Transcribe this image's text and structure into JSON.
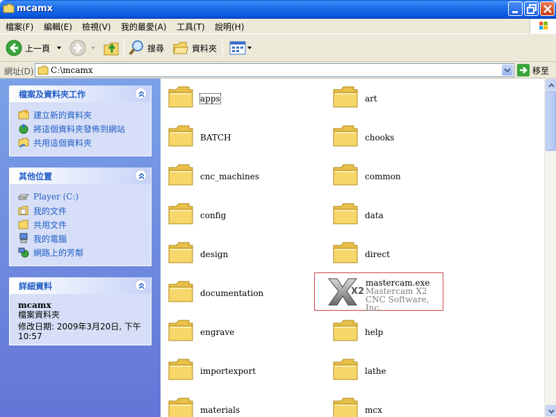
{
  "window": {
    "title": "mcamx"
  },
  "menu": {
    "items": [
      "檔案(F)",
      "編輯(E)",
      "檢視(V)",
      "我的最愛(A)",
      "工具(T)",
      "說明(H)"
    ]
  },
  "toolbar": {
    "back_label": "上一頁",
    "search_label": "搜尋",
    "folders_label": "資料夾"
  },
  "address": {
    "label": "網址(D)",
    "value": "C:\\mcamx",
    "go_label": "移至"
  },
  "taskpane": {
    "tasks": {
      "title": "檔案及資料夾工作",
      "items": [
        "建立新的資料夾",
        "將這個資料夾發佈到網站",
        "共用這個資料夾"
      ]
    },
    "other_places": {
      "title": "其他位置",
      "items": [
        "Player (C:)",
        "我的文件",
        "共用文件",
        "我的電腦",
        "網路上的芳鄰"
      ]
    },
    "details": {
      "title": "詳細資料",
      "name": "mcamx",
      "type": "檔案資料夾",
      "modified": "修改日期: 2009年3月20日, 下午 10:57"
    }
  },
  "content": {
    "folders_left": [
      "apps",
      "BATCH",
      "cnc_machines",
      "config",
      "design",
      "documentation",
      "engrave",
      "importexport",
      "materials"
    ],
    "folders_right": [
      "art",
      "chooks",
      "common",
      "data",
      "direct",
      "help",
      "lathe",
      "mcx"
    ],
    "exe": {
      "name": "mastercam.exe",
      "description": "Mastercam X2",
      "company": "CNC Software, Inc.",
      "icon_text": "X2"
    }
  },
  "colors": {
    "title_bar": "#0855dd",
    "taskpane_bg": "#7ba2e7",
    "link": "#215dc6",
    "folder": "#f7d76a",
    "highlight_border": "#cc4444"
  }
}
